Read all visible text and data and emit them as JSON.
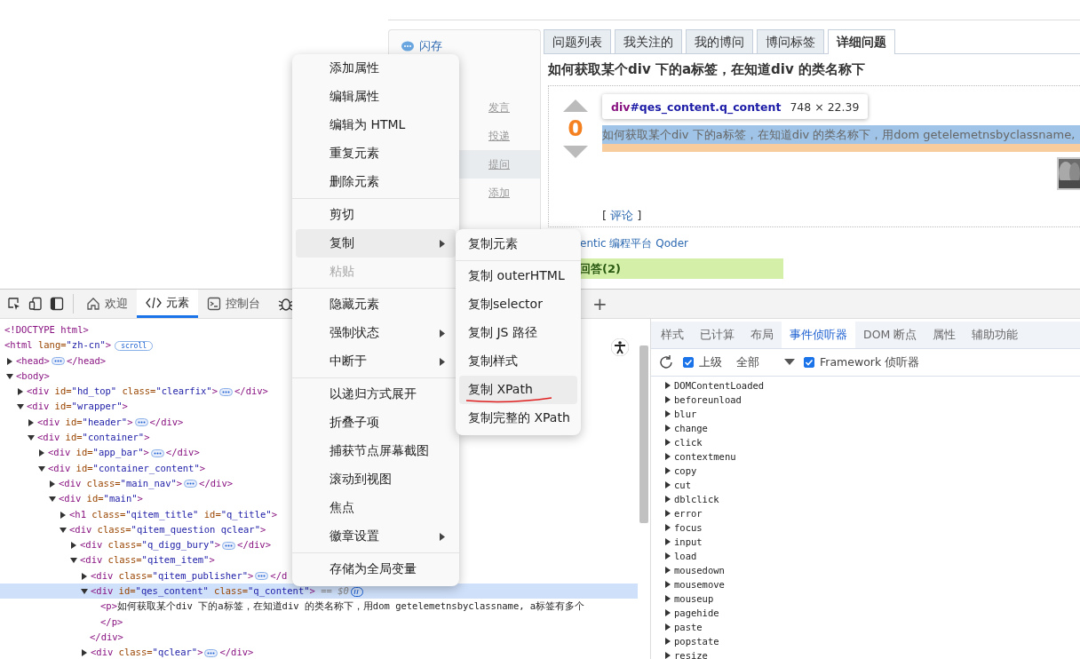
{
  "page": {
    "sidebar": {
      "flash": "闪存",
      "links": [
        {
          "label": "发言",
          "selected": false
        },
        {
          "label": "投递",
          "selected": false
        },
        {
          "label": "提问",
          "selected": true
        },
        {
          "label": "添加",
          "selected": false
        }
      ]
    },
    "tabs": [
      {
        "label": "问题列表",
        "selected": false
      },
      {
        "label": "我关注的",
        "selected": false
      },
      {
        "label": "我的博问",
        "selected": false
      },
      {
        "label": "博问标签",
        "selected": false
      },
      {
        "label": "详细问题",
        "selected": true
      }
    ],
    "question": {
      "title": "如何获取某个div 下的a标签，在知道div 的类名称下",
      "votes": "0",
      "content": "如何获取某个div 下的a标签，在知道div 的类名称下，用dom getelemetnsbyclassname,",
      "highlighted": true,
      "comment_open": "[",
      "comment": "评论",
      "comment_close": "]"
    },
    "ad_link": "entic 编程平台 Qoder",
    "answers_header": "回答(2)"
  },
  "inspect_tooltip": {
    "tag": "div",
    "selector": "#qes_content.q_content",
    "size": "748 × 22.39"
  },
  "devtools": {
    "tabs": [
      {
        "label": "欢迎",
        "selected": false
      },
      {
        "label": "元素",
        "selected": true
      },
      {
        "label": "控制台",
        "selected": false
      }
    ],
    "add_tab": "+",
    "dom_tree": [
      {
        "open": "<!DOCTYPE html>"
      },
      {
        "open": "<html lang=\"zh-cn\">",
        "badge_text": "scroll",
        "children": [
          {
            "open": "<head>",
            "ellipsis": true,
            "close": "</head>",
            "expanded": false
          },
          {
            "open": "<body>",
            "expanded": true,
            "children": [
              {
                "open": "<div id=\"hd_top\" class=\"clearfix\">",
                "ellipsis": true,
                "close": "</div>",
                "expanded": false
              },
              {
                "open": "<div id=\"wrapper\">",
                "expanded": true,
                "children": [
                  {
                    "open": "<div id=\"header\">",
                    "ellipsis": true,
                    "close": "</div>",
                    "expanded": false
                  },
                  {
                    "open": "<div id=\"container\">",
                    "expanded": true,
                    "children": [
                      {
                        "open": "<div id=\"app_bar\">",
                        "ellipsis": true,
                        "close": "</div>",
                        "expanded": false
                      },
                      {
                        "open": "<div id=\"container_content\">",
                        "expanded": true,
                        "children": [
                          {
                            "open": "<div class=\"main_nav\">",
                            "ellipsis": true,
                            "close": "</div>",
                            "expanded": false
                          },
                          {
                            "open": "<div id=\"main\">",
                            "expanded": true,
                            "children": [
                              {
                                "open": "<h1 class=\"qitem_title\" id=\"q_title\">",
                                "expanded": false
                              },
                              {
                                "open": "<div class=\"qitem_question qclear\">",
                                "expanded": true,
                                "children": [
                                  {
                                    "open": "<div class=\"q_digg_bury\">",
                                    "ellipsis": true,
                                    "close": "</div>",
                                    "expanded": false
                                  },
                                  {
                                    "open": "<div class=\"qitem_item\">",
                                    "expanded": true,
                                    "children": [
                                      {
                                        "open": "<div class=\"qitem_publisher\">",
                                        "ellipsis": true,
                                        "close": "</d",
                                        "expanded": false
                                      },
                                      {
                                        "open": "<div id=\"qes_content\" class=\"q_content\">",
                                        "expanded": true,
                                        "selected": true,
                                        "suffix": "== $0",
                                        "close_line": "</div>",
                                        "children": [
                                          {
                                            "open": "<p>",
                                            "text": "如何获取某个div 下的a标签，在知道div 的类名称下，用dom getelemetnsbyclassname, a标签有多个",
                                            "close_line": "</p>"
                                          }
                                        ]
                                      },
                                      {
                                        "open": "<div class=\"qclear\">",
                                        "ellipsis": true,
                                        "close": "</div>",
                                        "expanded": false
                                      }
                                    ]
                                  }
                                ]
                              }
                            ]
                          }
                        ]
                      }
                    ]
                  }
                ]
              }
            ]
          }
        ]
      }
    ],
    "side_tabs": [
      {
        "label": "样式",
        "selected": false
      },
      {
        "label": "已计算",
        "selected": false
      },
      {
        "label": "布局",
        "selected": false
      },
      {
        "label": "事件侦听器",
        "selected": true
      },
      {
        "label": "DOM 断点",
        "selected": false
      },
      {
        "label": "属性",
        "selected": false
      },
      {
        "label": "辅助功能",
        "selected": false
      }
    ],
    "listener_toolbar": {
      "ancestors": {
        "label": "上级",
        "checked": true
      },
      "scope": "全部",
      "framework": {
        "label": "Framework 侦听器",
        "checked": true
      }
    },
    "events": [
      "DOMContentLoaded",
      "beforeunload",
      "blur",
      "change",
      "click",
      "contextmenu",
      "copy",
      "cut",
      "dblclick",
      "error",
      "focus",
      "input",
      "load",
      "mousedown",
      "mousemove",
      "mouseup",
      "pagehide",
      "paste",
      "popstate",
      "resize"
    ]
  },
  "context_menu": {
    "groups": [
      [
        {
          "label": "添加属性",
          "kind": "item",
          "selected": false,
          "disabled": false
        },
        {
          "label": "编辑属性",
          "kind": "item",
          "selected": false,
          "disabled": false
        },
        {
          "label": "编辑为 HTML",
          "kind": "item",
          "selected": false,
          "disabled": false
        },
        {
          "label": "重复元素",
          "kind": "item",
          "selected": false,
          "disabled": false
        },
        {
          "label": "删除元素",
          "kind": "item",
          "selected": false,
          "disabled": false
        }
      ],
      [
        {
          "label": "剪切",
          "kind": "item",
          "selected": false,
          "disabled": false
        },
        {
          "label": "复制",
          "kind": "submenu",
          "selected": true,
          "disabled": false
        },
        {
          "label": "粘贴",
          "kind": "item",
          "selected": false,
          "disabled": true
        }
      ],
      [
        {
          "label": "隐藏元素",
          "kind": "item",
          "selected": false,
          "disabled": false
        },
        {
          "label": "强制状态",
          "kind": "submenu",
          "selected": false,
          "disabled": false
        },
        {
          "label": "中断于",
          "kind": "submenu",
          "selected": false,
          "disabled": false
        }
      ],
      [
        {
          "label": "以递归方式展开",
          "kind": "item",
          "selected": false,
          "disabled": false
        },
        {
          "label": "折叠子项",
          "kind": "item",
          "selected": false,
          "disabled": false
        },
        {
          "label": "捕获节点屏幕截图",
          "kind": "item",
          "selected": false,
          "disabled": false
        },
        {
          "label": "滚动到视图",
          "kind": "item",
          "selected": false,
          "disabled": false
        },
        {
          "label": "焦点",
          "kind": "item",
          "selected": false,
          "disabled": false
        },
        {
          "label": "徽章设置",
          "kind": "submenu",
          "selected": false,
          "disabled": false
        }
      ],
      [
        {
          "label": "存储为全局变量",
          "kind": "item",
          "selected": false,
          "disabled": false
        }
      ]
    ]
  },
  "submenu": {
    "groups": [
      [
        {
          "label": "复制元素",
          "selected": false,
          "underlined": false
        }
      ],
      [
        {
          "label": "复制 outerHTML",
          "selected": false,
          "underlined": false
        },
        {
          "label": "复制selector",
          "selected": false,
          "underlined": false
        },
        {
          "label": "复制 JS 路径",
          "selected": false,
          "underlined": false
        },
        {
          "label": "复制样式",
          "selected": false,
          "underlined": false
        },
        {
          "label": "复制 XPath",
          "selected": true,
          "underlined": true
        },
        {
          "label": "复制完整的 XPath",
          "selected": false,
          "underlined": false
        }
      ]
    ]
  }
}
